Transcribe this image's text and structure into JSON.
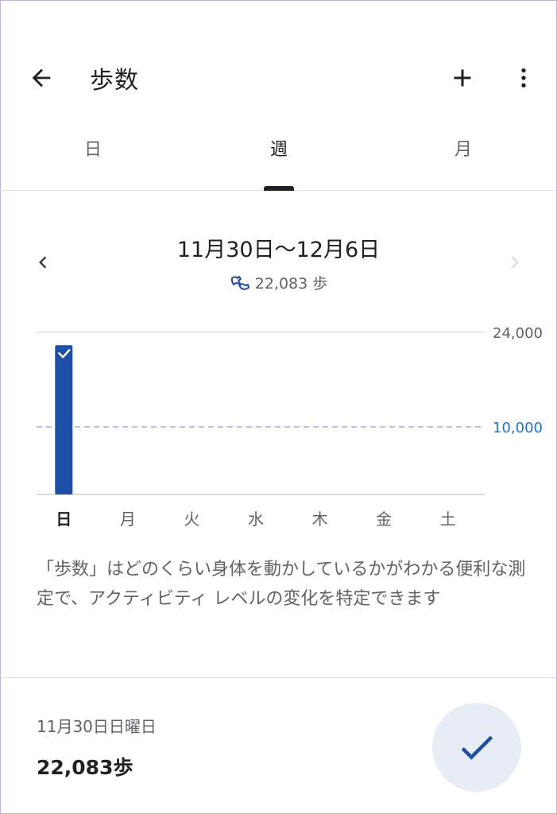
{
  "appbar": {
    "title": "歩数"
  },
  "tabs": [
    {
      "label": "日",
      "active": false
    },
    {
      "label": "週",
      "active": true
    },
    {
      "label": "月",
      "active": false
    }
  ],
  "range": {
    "title": "11月30日〜12月6日",
    "total": "22,083 歩"
  },
  "chart_data": {
    "type": "bar",
    "categories": [
      "日",
      "月",
      "火",
      "水",
      "木",
      "金",
      "土"
    ],
    "values": [
      22083,
      0,
      0,
      0,
      0,
      0,
      0
    ],
    "selected_index": 0,
    "ylim": [
      0,
      24000
    ],
    "y_top_label": "24,000",
    "goal_value": 10000,
    "goal_label": "10,000",
    "bar_color": "#1e4fa8",
    "goal_color": "#1a73e8"
  },
  "description": "「歩数」はどのくらい身体を動かしているかがわかる便利な測定で、アクティビティ レベルの変化を特定できます",
  "entry": {
    "date": "11月30日日曜日",
    "value": "22,083歩"
  },
  "colors": {
    "accent": "#1e4fa8",
    "fab_bg": "#e8ecf4"
  }
}
